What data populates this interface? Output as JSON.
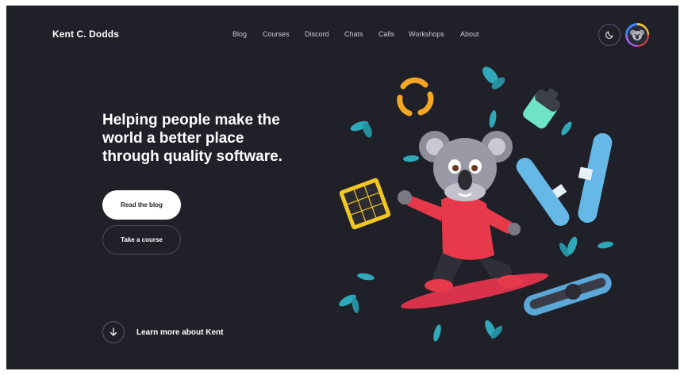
{
  "header": {
    "logo": "Kent C. Dodds",
    "nav": [
      {
        "id": "blog",
        "label": "Blog"
      },
      {
        "id": "courses",
        "label": "Courses"
      },
      {
        "id": "discord",
        "label": "Discord"
      },
      {
        "id": "chats",
        "label": "Chats"
      },
      {
        "id": "calls",
        "label": "Calls"
      },
      {
        "id": "workshops",
        "label": "Workshops"
      },
      {
        "id": "about",
        "label": "About"
      }
    ],
    "theme_icon": "moon-icon",
    "avatar_icon": "koala-avatar"
  },
  "hero": {
    "title_lines": [
      "Helping people make the",
      "world a better place",
      "through quality software."
    ],
    "primary_button": "Read the blog",
    "secondary_button": "Take a course"
  },
  "learn_more": {
    "icon": "arrow-down-icon",
    "label": "Learn more about Kent"
  },
  "colors": {
    "background": "#1f2028",
    "text": "#ffffff",
    "nav_text": "#c9cad3",
    "leaf": "#2fa8b9",
    "hoodie": "#e8394a",
    "recycle": "#f5a623",
    "solar": "#f2c623"
  }
}
